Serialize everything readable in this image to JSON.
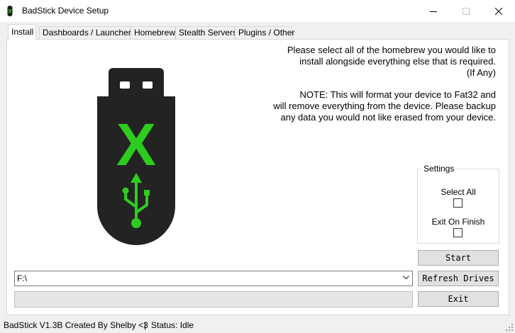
{
  "window": {
    "title": "BadStick Device Setup",
    "minimize_icon": "minimize-icon",
    "maximize_icon": "maximize-icon",
    "close_icon": "close-icon"
  },
  "tabs": [
    {
      "label": "Install",
      "active": true
    },
    {
      "label": "Dashboards / Launchers",
      "active": false
    },
    {
      "label": "Homebrew",
      "active": false
    },
    {
      "label": "Stealth Servers",
      "active": false
    },
    {
      "label": "Plugins / Other",
      "active": false
    }
  ],
  "install": {
    "info_lines": [
      "Please select all of the homebrew you would like to",
      "install alongside everything else that is required.",
      "(If Any)"
    ],
    "note_lines": [
      "NOTE: This will format your device to Fat32 and",
      "will remove everything from the device. Please backup",
      "any data you would not like erased from your device."
    ],
    "logo": {
      "icon": "usb-drive-icon",
      "letter": "X",
      "color_body": "#232323",
      "color_accent": "#2ecc1f"
    },
    "settings": {
      "legend": "Settings",
      "select_all_label": "Select All",
      "select_all_checked": false,
      "exit_on_finish_label": "Exit On Finish",
      "exit_on_finish_checked": false
    },
    "buttons": {
      "start": "Start",
      "refresh": "Refresh Drives",
      "exit": "Exit"
    },
    "drive": {
      "selected": "F:\\"
    },
    "progress": 0
  },
  "status": {
    "credit": "BadStick V1.3B Created By Shelby <3",
    "separator": "|",
    "state": "Status: Idle"
  }
}
